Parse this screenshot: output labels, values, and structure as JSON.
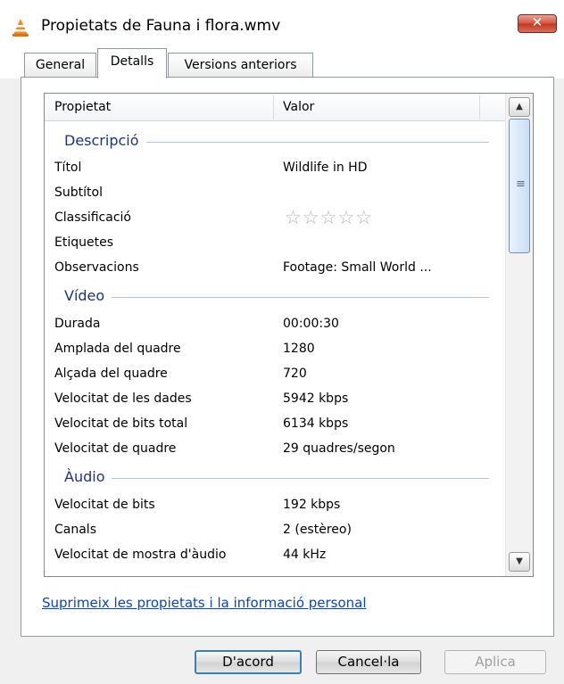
{
  "window": {
    "title": "Propietats de Fauna i flora.wmv",
    "close_label": "✕",
    "icon": "vlc-cone-icon"
  },
  "tabs": [
    {
      "label": "General",
      "active": false
    },
    {
      "label": "Detalls",
      "active": true
    },
    {
      "label": "Versions anteriors",
      "active": false
    }
  ],
  "table": {
    "columns": [
      "Propietat",
      "Valor"
    ],
    "groups": [
      {
        "label": "Descripció",
        "rows": [
          {
            "prop": "Títol",
            "value": "Wildlife in HD"
          },
          {
            "prop": "Subtítol",
            "value": ""
          },
          {
            "prop": "Classificació",
            "value": "",
            "rating": 0,
            "rating_max": 5
          },
          {
            "prop": "Etiquetes",
            "value": ""
          },
          {
            "prop": "Observacions",
            "value": "Footage: Small World ..."
          }
        ]
      },
      {
        "label": "Vídeo",
        "rows": [
          {
            "prop": "Durada",
            "value": "00:00:30"
          },
          {
            "prop": "Amplada del quadre",
            "value": "1280"
          },
          {
            "prop": "Alçada del quadre",
            "value": "720"
          },
          {
            "prop": "Velocitat de les dades",
            "value": "5942 kbps"
          },
          {
            "prop": "Velocitat de bits total",
            "value": "6134 kbps"
          },
          {
            "prop": "Velocitat de quadre",
            "value": "29 quadres/segon"
          }
        ]
      },
      {
        "label": "Àudio",
        "rows": [
          {
            "prop": "Velocitat de bits",
            "value": "192 kbps"
          },
          {
            "prop": "Canals",
            "value": "2 (estèreo)"
          },
          {
            "prop": "Velocitat de mostra d'àudio",
            "value": "44 kHz"
          }
        ]
      }
    ]
  },
  "link_text": "Suprimeix les propietats i la informació personal",
  "buttons": {
    "ok": "D'acord",
    "cancel": "Cancel·la",
    "apply": "Aplica"
  },
  "colors": {
    "group_heading": "#1e3287",
    "link": "#0645c8",
    "close_button": "#c4351f"
  }
}
